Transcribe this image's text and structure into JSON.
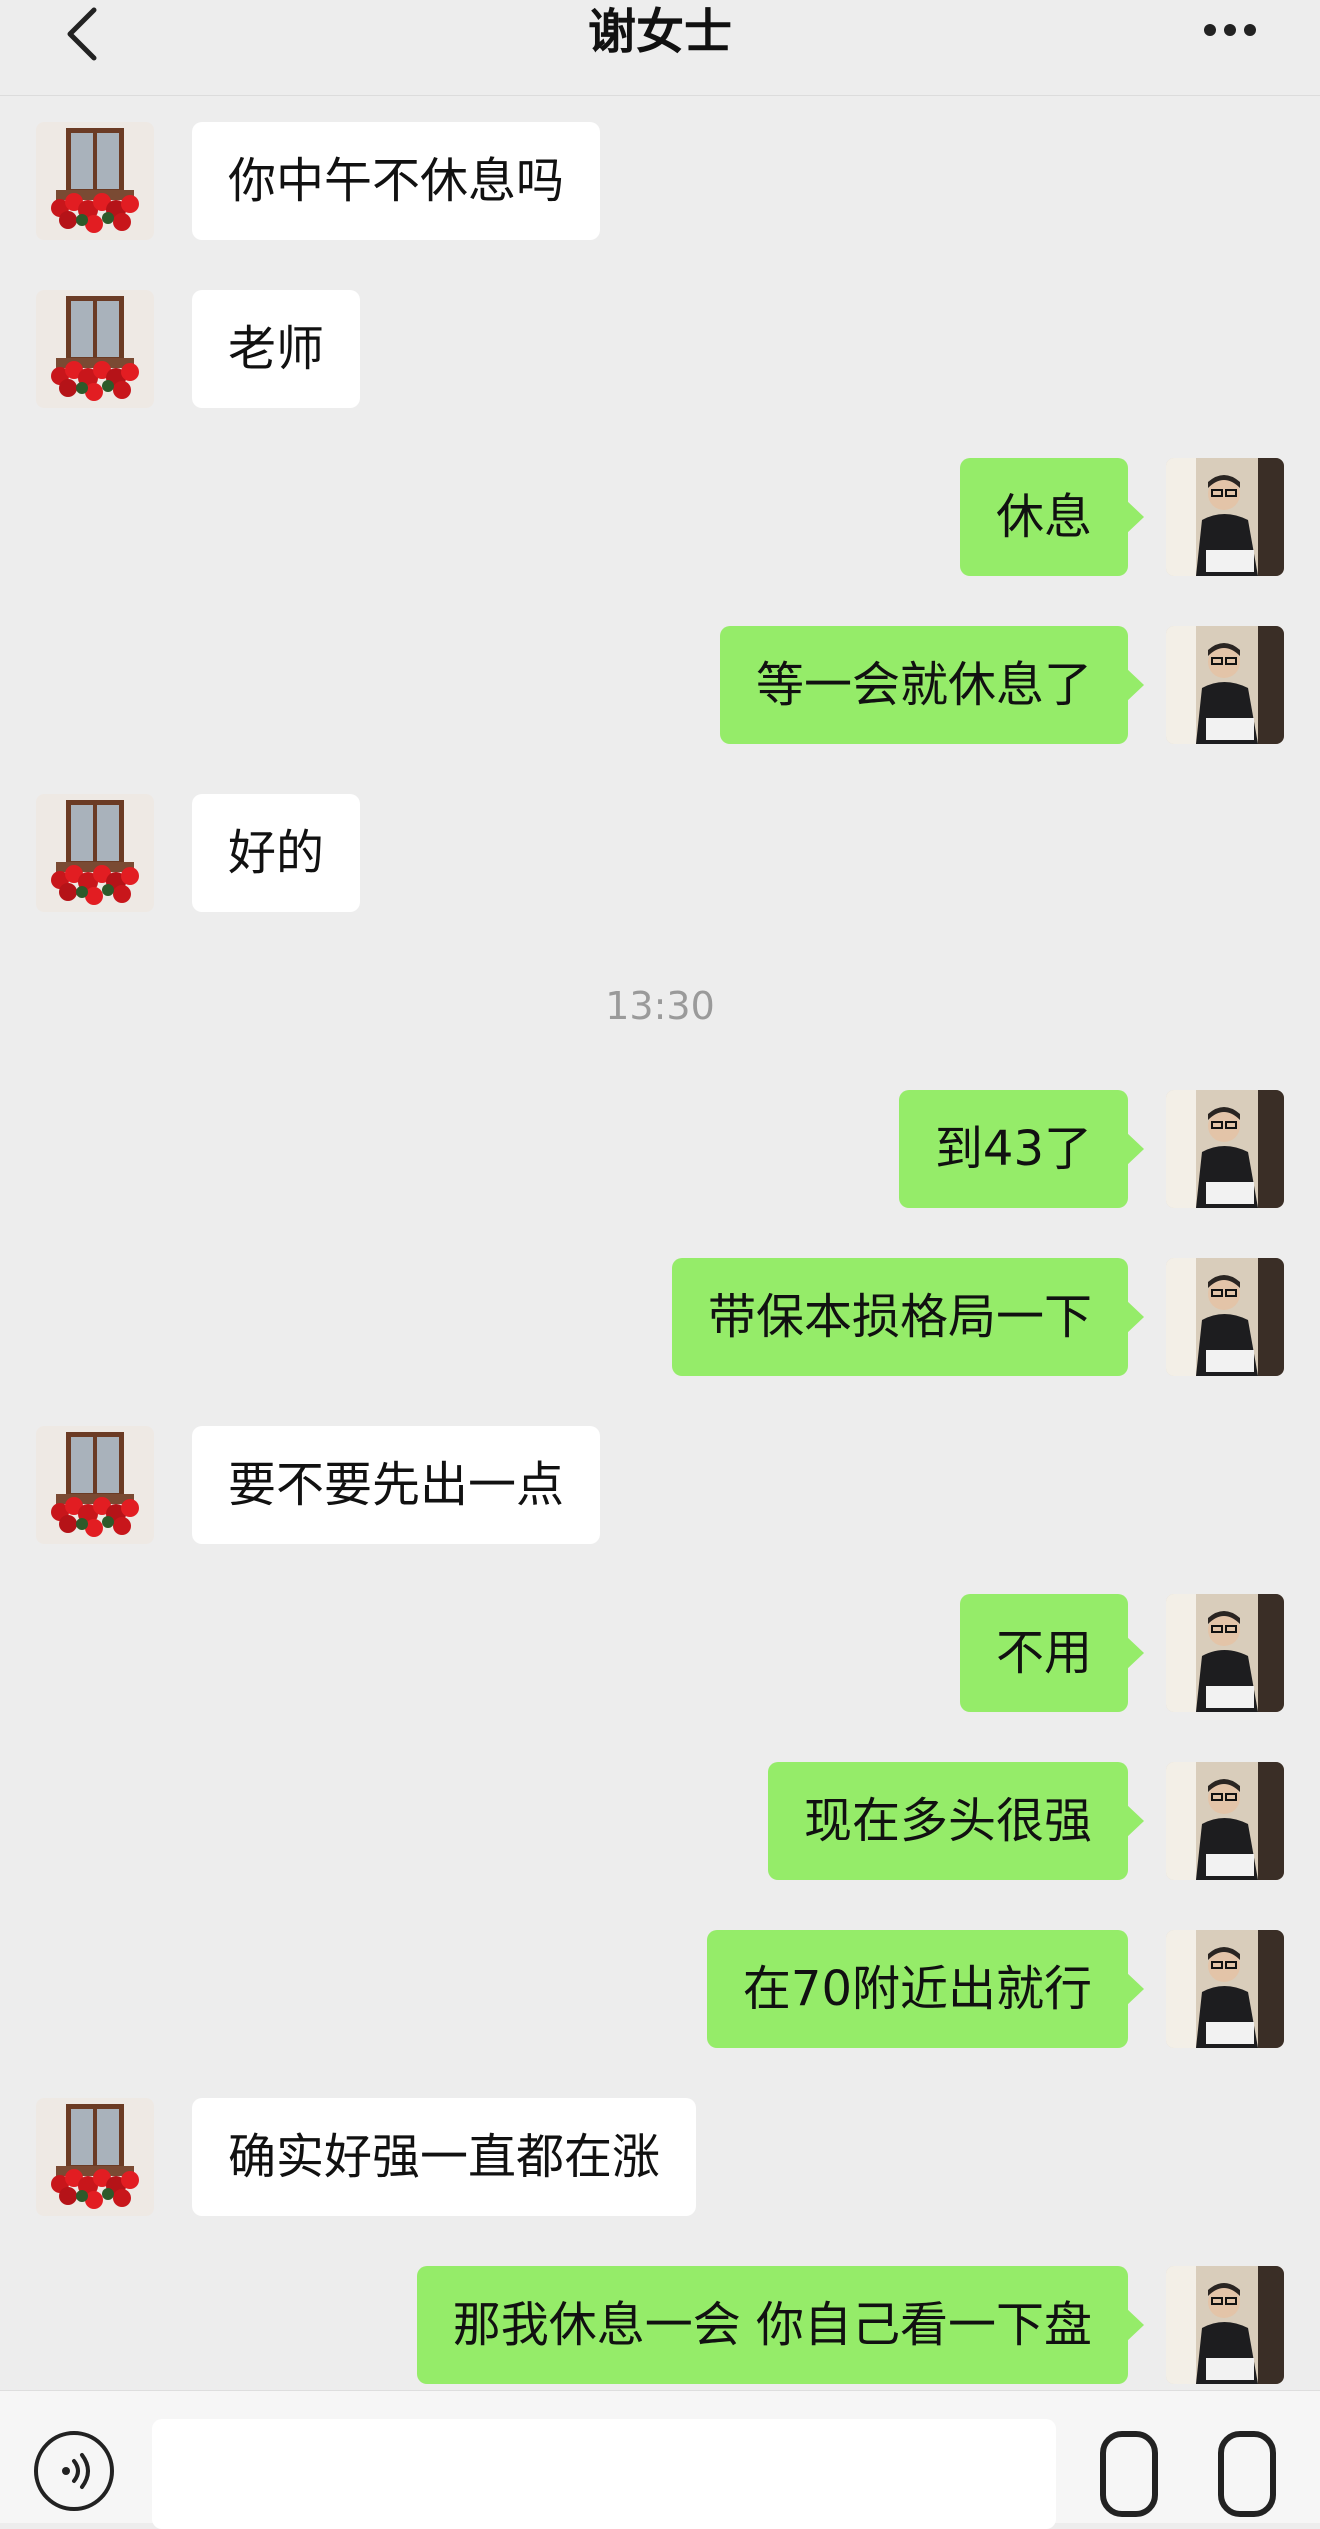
{
  "header": {
    "title": "谢女士",
    "back_icon": "chevron-left-icon",
    "more_icon": "more-horizontal-icon"
  },
  "messages": [
    {
      "side": "left",
      "text": "你中午不休息吗"
    },
    {
      "side": "left",
      "text": "老师"
    },
    {
      "side": "right",
      "text": "休息"
    },
    {
      "side": "right",
      "text": "等一会就休息了"
    },
    {
      "side": "left",
      "text": "好的"
    },
    {
      "side": "right",
      "text": "到43了"
    },
    {
      "side": "right",
      "text": "带保本损格局一下"
    },
    {
      "side": "left",
      "text": "要不要先出一点"
    },
    {
      "side": "right",
      "text": "不用"
    },
    {
      "side": "right",
      "text": "现在多头很强"
    },
    {
      "side": "right",
      "text": "在70附近出就行"
    },
    {
      "side": "left",
      "text": "确实好强一直都在涨"
    },
    {
      "side": "right",
      "text": "那我休息一会 你自己看一下盘"
    }
  ],
  "timestamp": "13:30",
  "input_bar": {
    "voice_icon": "voice-icon",
    "input_value": "",
    "emoji_icon": "emoji-icon",
    "plus_icon": "plus-icon"
  },
  "colors": {
    "background": "#ededed",
    "incoming_bubble": "#ffffff",
    "outgoing_bubble": "#95ec69"
  }
}
